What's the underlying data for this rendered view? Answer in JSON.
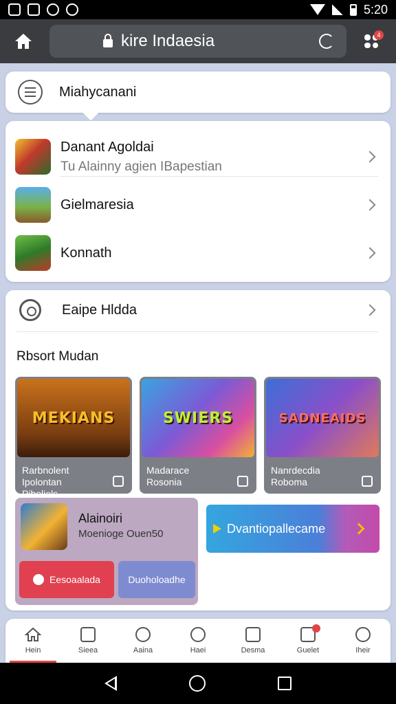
{
  "status_bar": {
    "time": "5:20"
  },
  "app_bar": {
    "url": "kire Indaesia",
    "notification_count": "4"
  },
  "search": {
    "text": "Miahycanani"
  },
  "list": [
    {
      "title": "Danant Agoldai",
      "subtitle": "Tu Alainny agien IBapestian",
      "icon": "game-thumb-1"
    },
    {
      "title": "Gielmaresia",
      "subtitle": "",
      "icon": "game-thumb-2"
    },
    {
      "title": "Konnath",
      "subtitle": "",
      "icon": "game-thumb-3"
    }
  ],
  "settings_row": {
    "label": "Eaipe Hldda"
  },
  "section": {
    "title": "Rbsort Mudan"
  },
  "tiles": [
    {
      "art_text": "MEKIANS",
      "caption_line1": "Rarbnolent Ipolontan",
      "caption_line2": "Piboliels"
    },
    {
      "art_text": "SWIERS",
      "caption_line1": "Madarace",
      "caption_line2": "Rosonia"
    },
    {
      "art_text": "SADNEAIDS",
      "caption_line1": "Nanrdecdia",
      "caption_line2": "Roboma"
    }
  ],
  "promo": {
    "title": "Alainoiri",
    "subtitle": "Moenioge Ouen50",
    "red_button": "Eesoaalada",
    "blue_button": "Duoholoadhe"
  },
  "cta": {
    "label": "Dvantiopallecame"
  },
  "bottom_nav": [
    {
      "label": "Hein",
      "icon": "home-icon",
      "active": true
    },
    {
      "label": "Sieea",
      "icon": "store-icon"
    },
    {
      "label": "Aaina",
      "icon": "search-icon"
    },
    {
      "label": "Haei",
      "icon": "gamepad-icon"
    },
    {
      "label": "Desma",
      "icon": "list-icon"
    },
    {
      "label": "Guelet",
      "icon": "bag-icon"
    },
    {
      "label": "Iheir",
      "icon": "profile-icon"
    }
  ],
  "colors": {
    "appbar": "#3a3c40",
    "accent_red": "#e04545",
    "cta_start": "#34a6df",
    "cta_end": "#c44aa9"
  }
}
